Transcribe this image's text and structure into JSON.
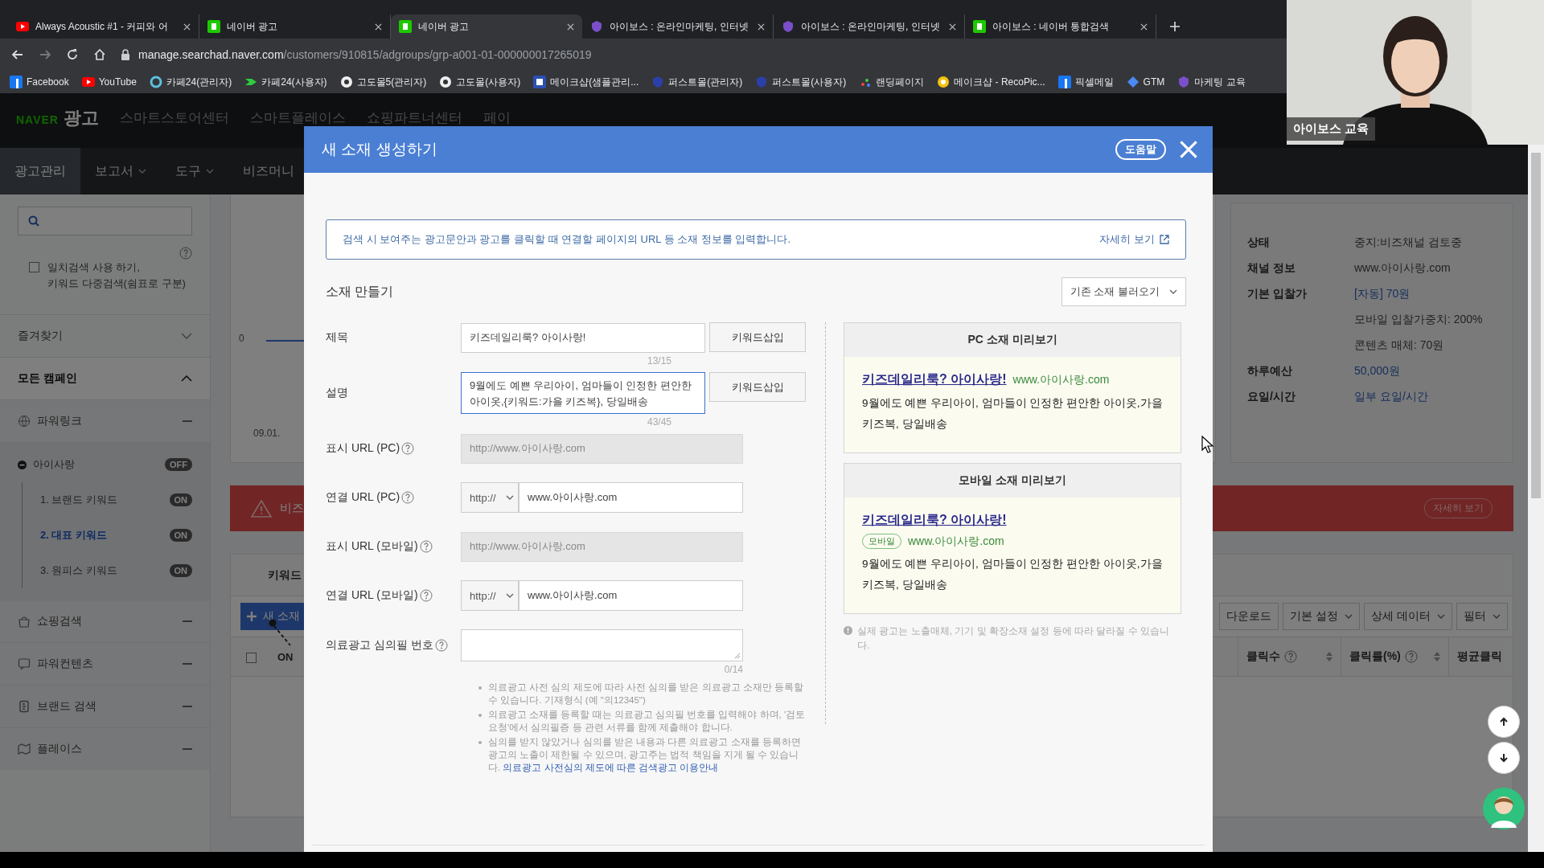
{
  "browser": {
    "tabs": [
      {
        "title": "Always Acoustic #1 - 커피와 어",
        "kind": "play",
        "selected": false
      },
      {
        "title": "네이버 광고",
        "kind": "naver",
        "selected": false
      },
      {
        "title": "네이버 광고",
        "kind": "naver",
        "selected": true
      },
      {
        "title": "아이보스 : 온라인마케팅, 인터넷",
        "kind": "iboss",
        "selected": false
      },
      {
        "title": "아이보스 : 온라인마케팅, 인터넷",
        "kind": "iboss",
        "selected": false
      },
      {
        "title": "아이보스 : 네이버 통합검색",
        "kind": "naver",
        "selected": false
      }
    ],
    "url": {
      "host": "manage.searchad.naver.com",
      "path": "/customers/910815/adgroups/grp-a001-01-000000017265019"
    },
    "bookmarks": [
      {
        "label": "Facebook",
        "kind": "facebook"
      },
      {
        "label": "YouTube",
        "kind": "play"
      },
      {
        "label": "카페24(관리자)",
        "kind": "ring"
      },
      {
        "label": "카페24(사용자)",
        "kind": "chevron"
      },
      {
        "label": "고도몰5(관리자)",
        "kind": "globe"
      },
      {
        "label": "고도몰(사용자)",
        "kind": "globe"
      },
      {
        "label": "메이크샵(샘플관리...",
        "kind": "square"
      },
      {
        "label": "퍼스트몰(관리자)",
        "kind": "shield"
      },
      {
        "label": "퍼스트몰(사용자)",
        "kind": "shield"
      },
      {
        "label": "랜딩페이지",
        "kind": "dots"
      },
      {
        "label": "메이크샵 - RecoPic...",
        "kind": "coin"
      },
      {
        "label": "픽셀메일",
        "kind": "facebook"
      },
      {
        "label": "GTM",
        "kind": "diamond"
      },
      {
        "label": "마케팅 교육",
        "kind": "iboss"
      }
    ]
  },
  "app_header": {
    "logo_brand": "NAVER",
    "logo_product": "광고",
    "links": [
      "스마트스토어센터",
      "스마트플레이스",
      "쇼핑파트너센터",
      "페이"
    ]
  },
  "nav": [
    {
      "label": "광고관리",
      "selected": true,
      "dropdown": false
    },
    {
      "label": "보고서",
      "selected": false,
      "dropdown": true
    },
    {
      "label": "도구",
      "selected": false,
      "dropdown": true
    },
    {
      "label": "비즈머니",
      "selected": false,
      "dropdown": false
    }
  ],
  "sidebar": {
    "exact_match": {
      "label": "일치검색 사용 하기,\n키워드 다중검색(쉼표로 구분)",
      "checked": false
    },
    "favorites": {
      "label": "즐겨찾기",
      "expanded": false
    },
    "campaigns": {
      "label": "모든 캠페인",
      "expanded": true
    },
    "types": [
      {
        "label": "파워링크",
        "kind": "globe",
        "children": [
          {
            "label": "아이사랑",
            "status": "OFF",
            "children": [
              {
                "label": "1. 브랜드 키워드",
                "status": "ON",
                "selected": false
              },
              {
                "label": "2. 대표 키워드",
                "status": "ON",
                "selected": true
              },
              {
                "label": "3. 원피스 키워드",
                "status": "ON",
                "selected": false
              }
            ]
          }
        ]
      },
      {
        "label": "쇼핑검색",
        "kind": "bag"
      },
      {
        "label": "파워컨텐츠",
        "kind": "chat"
      },
      {
        "label": "브랜드 검색",
        "kind": "brand"
      },
      {
        "label": "플레이스",
        "kind": "map"
      }
    ]
  },
  "chart": {
    "y_tick": "0",
    "x_tick": "09.01."
  },
  "alert": {
    "text": "비즈",
    "button": "자세히 보기"
  },
  "info_panel": [
    {
      "label": "상태",
      "values": [
        {
          "text": "중지:비즈채널 검토중",
          "link": false
        }
      ]
    },
    {
      "label": "채널 정보",
      "values": [
        {
          "text": "www.아이사랑.com",
          "link": false
        }
      ]
    },
    {
      "label": "기본 입찰가",
      "values": [
        {
          "text": "[자동] 70원",
          "link": true
        },
        {
          "text": "모바일 입찰가중치: 200%",
          "link": false
        },
        {
          "text": "콘텐츠 매체: 70원",
          "link": false
        }
      ]
    },
    {
      "label": "하루예산",
      "values": [
        {
          "text": "50,000원",
          "link": true
        }
      ]
    },
    {
      "label": "요일/시간",
      "values": [
        {
          "text": "일부 요일/시간",
          "link": true
        }
      ]
    }
  ],
  "table": {
    "tab": "키워드",
    "new_button": "새 소재",
    "row_toggle": "ON",
    "header_checked": false,
    "tools": [
      {
        "label": "다운로드",
        "dropdown": false
      },
      {
        "label": "기본 설정",
        "dropdown": true
      },
      {
        "label": "상세 데이터",
        "dropdown": true
      },
      {
        "label": "필터",
        "dropdown": true
      }
    ],
    "columns": [
      {
        "label": "클릭수",
        "help": true,
        "sortable": true
      },
      {
        "label": "클릭률(%)",
        "help": true,
        "sortable": true
      },
      {
        "label": "평균클릭",
        "help": false,
        "sortable": false
      }
    ]
  },
  "modal": {
    "title": "새 소재 생성하기",
    "help_button": "도움말",
    "info": "검색 시 보여주는 광고문안과 광고를 클릭할 때 연결할 페이지의 URL 등 소재 정보를 입력합니다.",
    "info_link": "자세히 보기",
    "section_title": "소재 만들기",
    "load_button": "기존 소재 불러오기",
    "fields": [
      {
        "kind": "text",
        "label": "제목",
        "value": "키즈데일리룩? 아이사랑!",
        "button": "키워드삽입",
        "counter": "13/15",
        "focused": false
      },
      {
        "kind": "textarea",
        "label": "설명",
        "value": "9월에도 예쁜 우리아이, 엄마들이 인정한 편안한 아이옷,{키워드:가을 키즈복}, 당일배송",
        "button": "키워드삽입",
        "counter": "43/45",
        "focused": true
      },
      {
        "kind": "display",
        "label": "표시 URL (PC)",
        "value": "http://www.아이사랑.com",
        "disabled": true
      },
      {
        "kind": "link",
        "label": "연결 URL (PC)",
        "protocol": "http://",
        "value": "www.아이사랑.com"
      },
      {
        "kind": "display",
        "label": "표시 URL (모바일)",
        "value": "http://www.아이사랑.com",
        "disabled": true
      },
      {
        "kind": "link",
        "label": "연결 URL (모바일)",
        "protocol": "http://",
        "value": "www.아이사랑.com"
      },
      {
        "kind": "memo",
        "label": "의료광고 심의필 번호",
        "counter": "0/14"
      }
    ],
    "notes": [
      {
        "text": "의료광고 사전 심의 제도에 따라 사전 심의를 받은 의료광고 소재만 등록할 수 있습니다. 기재형식 (예 \"의12345\")"
      },
      {
        "text": "의료광고 소재를 등록할 때는 의료광고 심의필 번호를 입력해야 하며, '검토요청'에서 심의필증 등 관련 서류를 함께 제출해야 합니다."
      },
      {
        "text": "심의를 받지 않았거나 심의를 받은 내용과 다른 의료광고 소재를 등록하면 광고의 노출이 제한될 수 있으며, 광고주는 법적 책임을 지게 될 수 있습니다.",
        "link": "의료광고 사전심의 제도에 따른 검색광고 이용안내"
      }
    ],
    "previews": [
      {
        "title": "PC 소재 미리보기",
        "headline": "키즈데일리룩? 아이사랑!",
        "display_url": "www.아이사랑.com",
        "description": "9월에도 예쁜 우리아이, 엄마들이 인정한 편안한 아이옷,가을 키즈복, 당일배송"
      },
      {
        "title": "모바일 소재 미리보기",
        "headline": "키즈데일리룩? 아이사랑!",
        "badge": "모바일",
        "display_url": "www.아이사랑.com",
        "description": "9월에도 예쁜 우리아이, 엄마들이 인정한 편안한 아이옷,가을 키즈복, 당일배송"
      }
    ],
    "preview_note": "실제 광고는 노출매체, 기기 및 확장소재 설정 등에 따라 달라질 수 있습니다."
  },
  "webcam": {
    "kind": "picture",
    "caption": "아이보스 교육"
  }
}
